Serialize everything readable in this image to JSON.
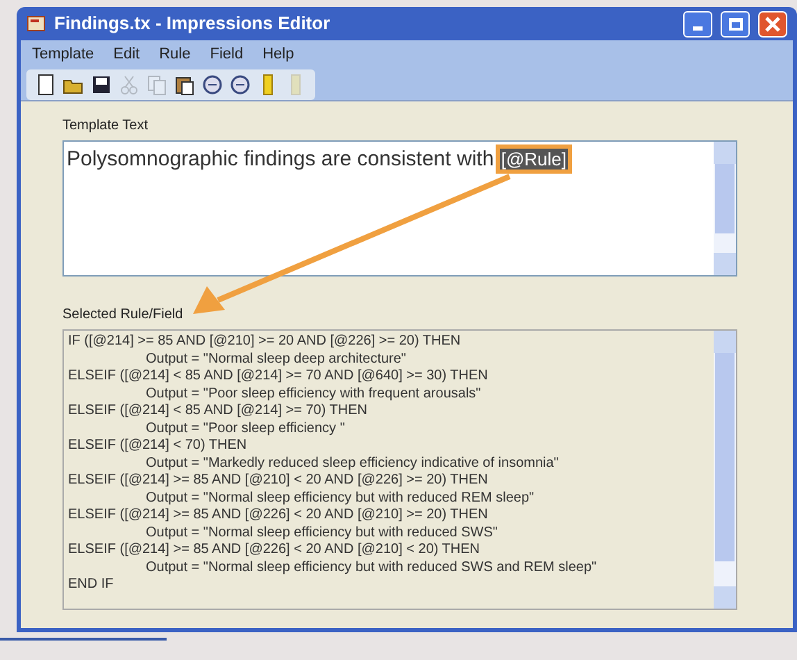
{
  "window": {
    "title": "Findings.tx - Impressions Editor"
  },
  "menu": [
    "Template",
    "Edit",
    "Rule",
    "Field",
    "Help"
  ],
  "toolbar": [
    {
      "kind": "new",
      "disabled": false
    },
    {
      "kind": "open",
      "disabled": false
    },
    {
      "kind": "save",
      "disabled": false
    },
    {
      "kind": "cut",
      "disabled": true
    },
    {
      "kind": "copy",
      "disabled": true
    },
    {
      "kind": "paste",
      "disabled": false
    },
    {
      "kind": "circle",
      "disabled": false
    },
    {
      "kind": "circle",
      "disabled": false
    },
    {
      "kind": "column",
      "disabled": false
    },
    {
      "kind": "column",
      "disabled": true
    }
  ],
  "template_text": {
    "label": "Template Text",
    "text": "Polysomnographic findings are consistent with ",
    "token": "[@Rule]"
  },
  "selected_rule": {
    "label": "Selected Rule/Field",
    "lines": [
      {
        "kind": "condition",
        "text": "IF ([@214] >= 85 AND [@210] >= 20 AND [@226] >= 20) THEN"
      },
      {
        "kind": "output",
        "text": "Output = \"Normal sleep deep architecture\""
      },
      {
        "kind": "condition",
        "text": "ELSEIF ([@214] < 85 AND [@214] >= 70 AND [@640] >= 30) THEN"
      },
      {
        "kind": "output",
        "text": "Output = \"Poor sleep efficiency with frequent arousals\""
      },
      {
        "kind": "condition",
        "text": "ELSEIF ([@214] < 85 AND [@214] >= 70) THEN"
      },
      {
        "kind": "output",
        "text": "Output = \"Poor sleep efficiency \""
      },
      {
        "kind": "condition",
        "text": "ELSEIF ([@214] < 70) THEN"
      },
      {
        "kind": "output",
        "text": "Output = \"Markedly reduced sleep efficiency indicative of insomnia\""
      },
      {
        "kind": "condition",
        "text": "ELSEIF ([@214] >= 85 AND [@210] < 20 AND [@226] >= 20) THEN"
      },
      {
        "kind": "output",
        "text": "Output = \"Normal sleep efficiency but with reduced REM sleep\""
      },
      {
        "kind": "condition",
        "text": "ELSEIF ([@214] >= 85 AND [@226] < 20 AND [@210] >= 20) THEN"
      },
      {
        "kind": "output",
        "text": "Output = \"Normal sleep efficiency but with reduced SWS\""
      },
      {
        "kind": "condition",
        "text": "ELSEIF ([@214] >= 85 AND [@226] < 20 AND [@210] < 20) THEN"
      },
      {
        "kind": "output",
        "text": "Output = \"Normal sleep efficiency but with reduced SWS and REM sleep\""
      },
      {
        "kind": "condition",
        "text": "END IF"
      }
    ]
  }
}
